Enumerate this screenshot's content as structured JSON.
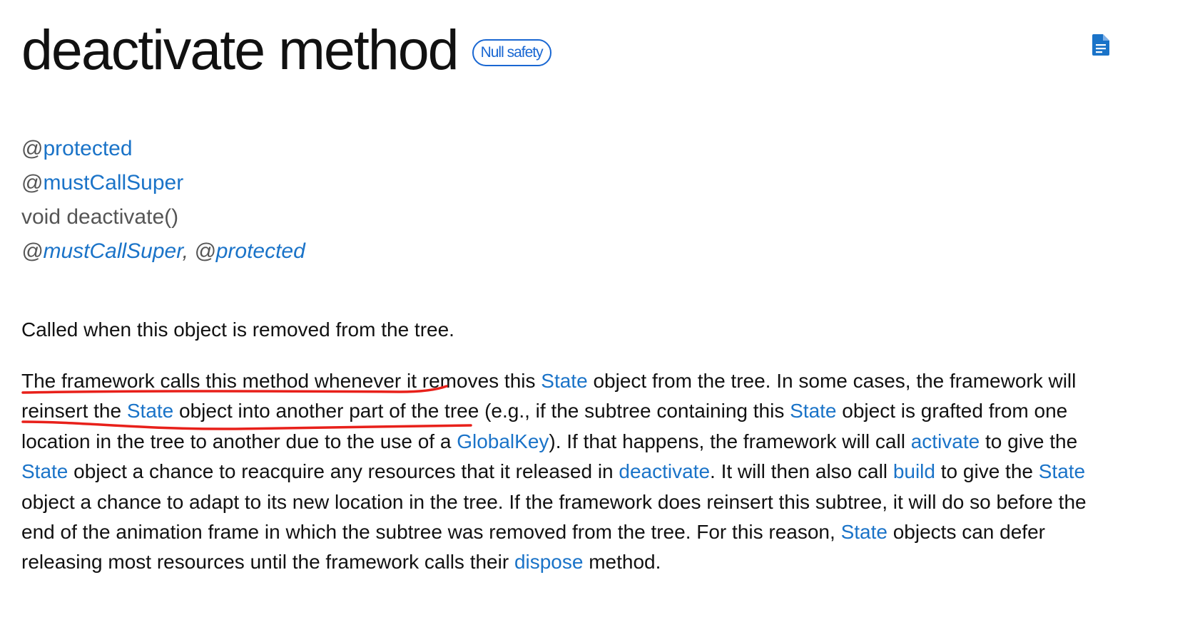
{
  "header": {
    "title": "deactivate method",
    "badge": "Null safety",
    "doc_icon": "document-icon"
  },
  "signature": {
    "annotation_protected": "@protected",
    "annotation_must_call_super": "@mustCallSuper",
    "declaration": "void deactivate()",
    "annotation_list": {
      "must_call_super": "@mustCallSuper",
      "separator": ", ",
      "protected": "@protected"
    }
  },
  "description": {
    "summary": "Called when this object is removed from the tree.",
    "body_lines": [
      [
        {
          "text": "The framework calls this method whenever it removes this "
        },
        {
          "text": "State",
          "link": true
        },
        {
          "text": " object from the tree. In some cases, the framework will"
        }
      ],
      [
        {
          "text": "reinsert the "
        },
        {
          "text": "State",
          "link": true
        },
        {
          "text": " object into another part of the tree (e.g., if the subtree containing this "
        },
        {
          "text": "State",
          "link": true
        },
        {
          "text": " object is grafted from one"
        }
      ],
      [
        {
          "text": "location in the tree to another due to the use of a "
        },
        {
          "text": "GlobalKey",
          "link": true
        },
        {
          "text": "). If that happens, the framework will call "
        },
        {
          "text": "activate",
          "link": true
        },
        {
          "text": " to give the"
        }
      ],
      [
        {
          "text": "State",
          "link": true
        },
        {
          "text": " object a chance to reacquire any resources that it released in "
        },
        {
          "text": "deactivate",
          "link": true
        },
        {
          "text": ". It will then also call "
        },
        {
          "text": "build",
          "link": true
        },
        {
          "text": " to give the "
        },
        {
          "text": "State",
          "link": true
        }
      ],
      [
        {
          "text": "object a chance to adapt to its new location in the tree. If the framework does reinsert this subtree, it will do so before the"
        }
      ],
      [
        {
          "text": "end of the animation frame in which the subtree was removed from the tree. For this reason, "
        },
        {
          "text": "State",
          "link": true
        },
        {
          "text": " objects can defer"
        }
      ],
      [
        {
          "text": "releasing most resources until the framework calls their "
        },
        {
          "text": "dispose",
          "link": true
        },
        {
          "text": " method."
        }
      ]
    ]
  },
  "colors": {
    "link": "#1a73c8",
    "badge": "#1967d2",
    "annotation_underline": "#e8201a",
    "text": "#111111",
    "muted": "#555555"
  }
}
